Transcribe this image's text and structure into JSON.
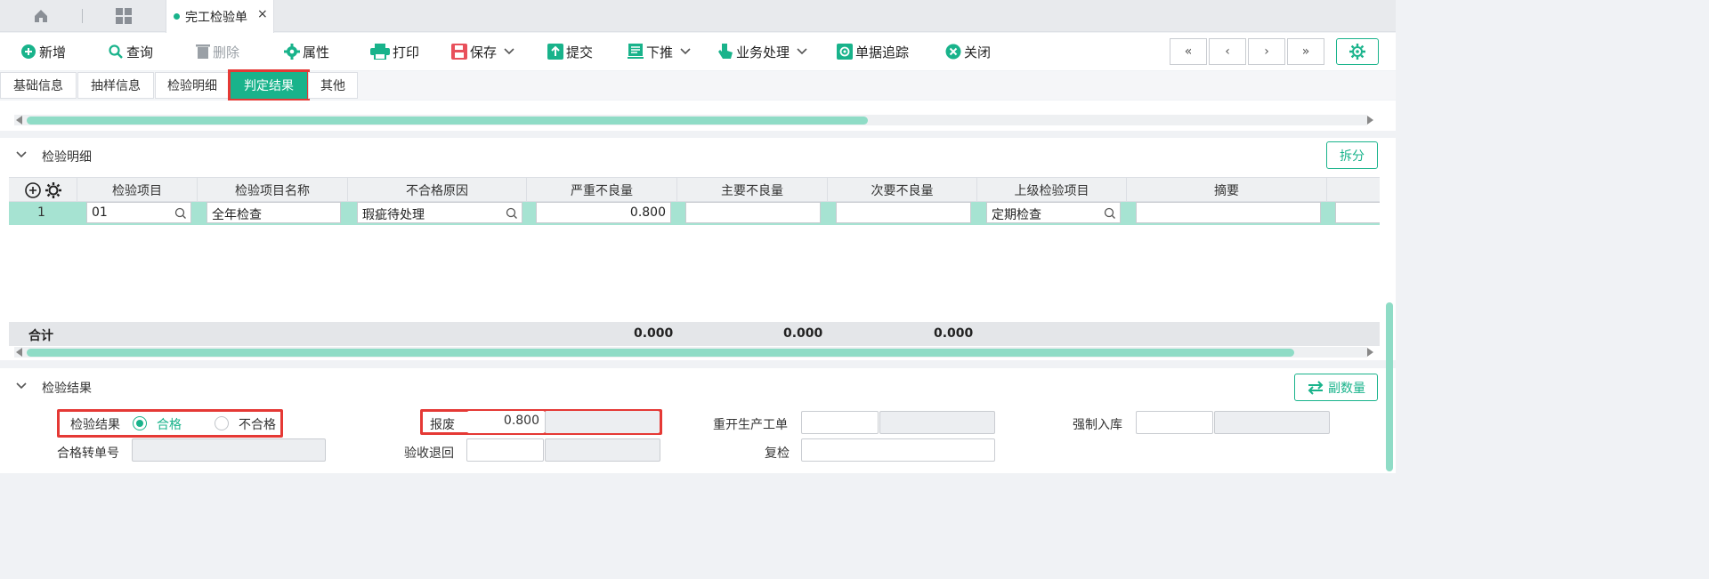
{
  "tabbar": {
    "doc_tab_label": "完工检验单",
    "close_glyph": "×",
    "accent": "#19b38b"
  },
  "toolbar": {
    "new": "新增",
    "query": "查询",
    "delete": "删除",
    "properties": "属性",
    "print": "打印",
    "save": "保存",
    "submit": "提交",
    "push_down": "下推",
    "business": "业务处理",
    "trace": "单据追踪",
    "close": "关闭",
    "nav": [
      "«",
      "‹",
      "›",
      "»"
    ]
  },
  "section_tabs": [
    "基础信息",
    "抽样信息",
    "检验明细",
    "判定结果",
    "其他"
  ],
  "detail": {
    "title": "检验明细",
    "split_button": "拆分",
    "columns": [
      "检验项目",
      "检验项目名称",
      "不合格原因",
      "严重不良量",
      "主要不良量",
      "次要不良量",
      "上级检验项目",
      "摘要"
    ],
    "rows": [
      {
        "seq": "1",
        "item": "01",
        "item_name": "全年检查",
        "reason": "瑕疵待处理",
        "severe": "0.800",
        "major": "",
        "minor": "",
        "parent": "定期检查",
        "summary": ""
      }
    ],
    "total_label": "合计",
    "totals": {
      "severe": "0.000",
      "major": "0.000",
      "minor": "0.000"
    }
  },
  "result": {
    "title": "检验结果",
    "aux_qty_button": "副数量",
    "result_label": "检验结果",
    "pass_label": "合格",
    "fail_label": "不合格",
    "selected": "合格",
    "scrap_label": "报废",
    "scrap_value": "0.800",
    "reopen_label": "重开生产工单",
    "force_in_label": "强制入库",
    "pass_transfer_label": "合格转单号",
    "return_label": "验收退回",
    "recheck_label": "复检"
  },
  "colors": {
    "accent": "#19b38b",
    "highlight_red": "#e53935",
    "row_selected": "#a6e3d2"
  }
}
